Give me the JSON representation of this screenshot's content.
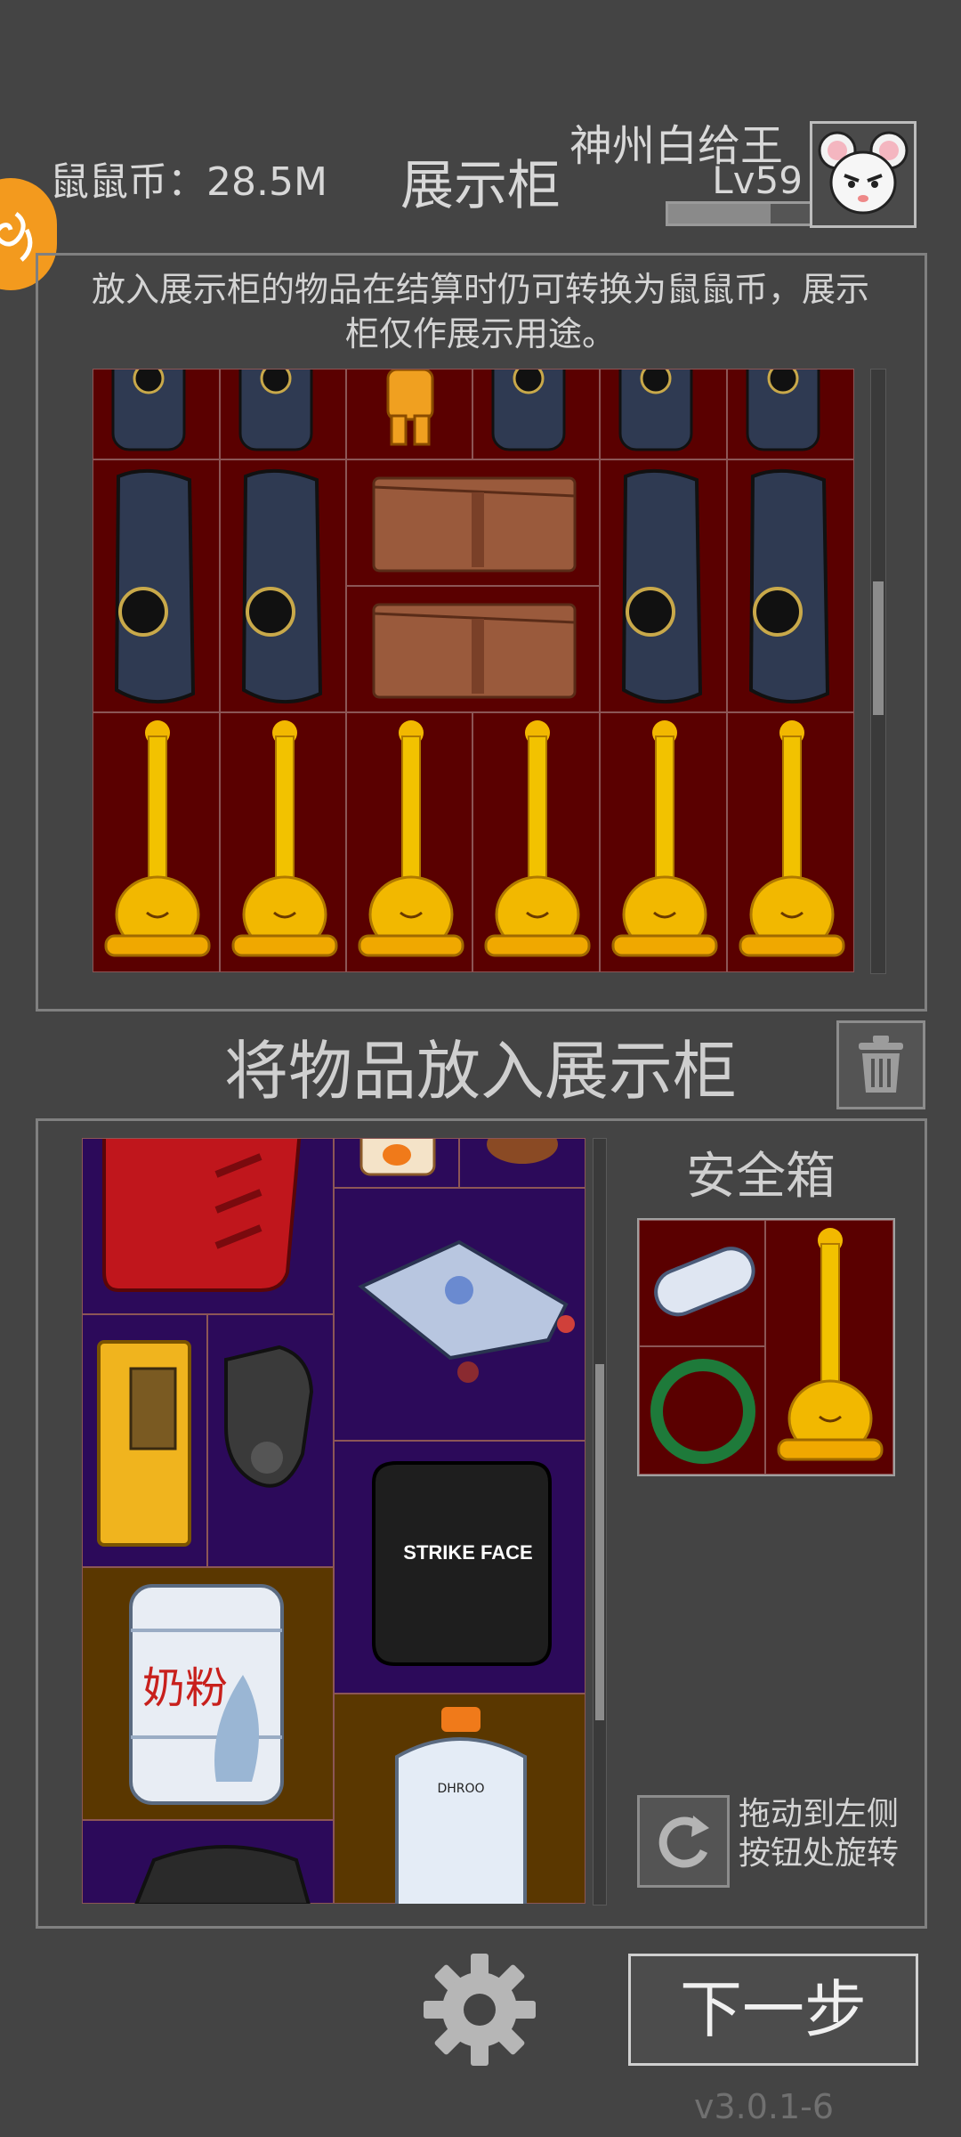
{
  "header": {
    "coins_text": "鼠鼠币：28.5M",
    "title": "展示柜",
    "player_name": "神州白给王",
    "level": "Lv59",
    "xp_progress": 0.72
  },
  "display_cabinet": {
    "notice": "放入展示柜的物品在结算时仍可转换为鼠鼠币，展示柜仅作展示用途。",
    "items": [
      "armor-plate",
      "armor-plate",
      "astronaut-figurine",
      "armor-plate",
      "armor-plate",
      "armor-plate",
      "armor-plate",
      "armor-plate",
      "leather-folder",
      "armor-plate",
      "armor-plate",
      "leather-folder",
      "golden-trophy",
      "golden-trophy",
      "golden-trophy",
      "golden-trophy",
      "golden-trophy",
      "golden-trophy"
    ],
    "scroll_position": 0.45
  },
  "put_in": {
    "title": "将物品放入展示柜"
  },
  "inventory": {
    "items": [
      "red-jerry-can",
      "juice-bottle",
      "space-fighter",
      "golden-book",
      "gas-mask",
      "strike-face-plate",
      "milk-powder-jug",
      "liquid-nitrogen-tank",
      "tactical-backpack"
    ],
    "plate_text": "STRIKE FACE",
    "jug_text": "奶粉",
    "scroll_position": 0.55
  },
  "safe_box": {
    "title": "安全箱",
    "items": [
      "pill-capsule",
      "golden-trophy",
      "jade-bangle"
    ]
  },
  "rotate_hint": {
    "line1": "拖动到左侧",
    "line2": "按钮处旋转"
  },
  "footer": {
    "next_label": "下一步",
    "version": "v3.0.1-6"
  },
  "colors": {
    "background": "#444444",
    "cabinet_cell": "#5a0000",
    "inventory_purple": "#2c0a5a",
    "inventory_brown": "#5a3700",
    "accent_orange": "#f39a1e"
  }
}
